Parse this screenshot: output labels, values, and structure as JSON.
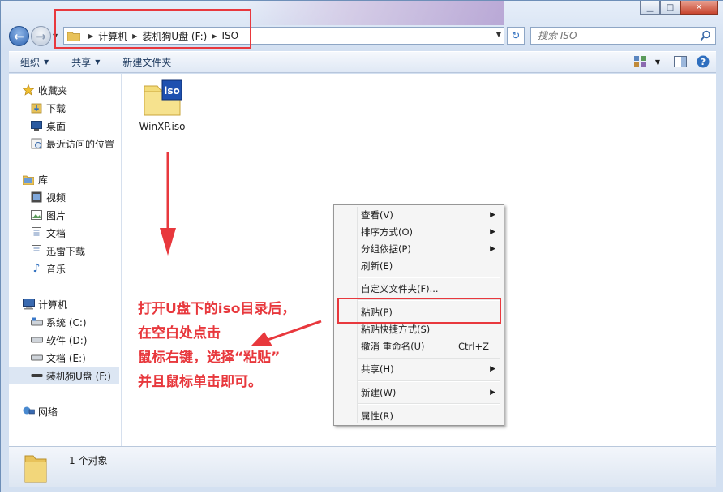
{
  "window": {
    "caption_buttons": {
      "minimize": "▁",
      "maximize": "□",
      "close": "✕"
    }
  },
  "nav": {
    "back_icon": "back-arrow-icon",
    "forward_icon": "forward-arrow-icon"
  },
  "address": {
    "crumbs": [
      "计算机",
      "装机狗U盘 (F:)",
      "ISO"
    ]
  },
  "search": {
    "placeholder": "搜索 ISO"
  },
  "toolbar": {
    "organize": "组织",
    "share": "共享",
    "new_folder": "新建文件夹"
  },
  "sidebar": {
    "favorites": {
      "label": "收藏夹",
      "items": [
        "下载",
        "桌面",
        "最近访问的位置"
      ]
    },
    "libraries": {
      "label": "库",
      "items": [
        "视频",
        "图片",
        "文档",
        "迅雷下载",
        "音乐"
      ]
    },
    "computer": {
      "label": "计算机",
      "items": [
        "系统 (C:)",
        "软件 (D:)",
        "文档 (E:)",
        "装机狗U盘 (F:)"
      ]
    },
    "network": {
      "label": "网络"
    }
  },
  "content": {
    "files": [
      {
        "name": "WinXP.iso",
        "icon_text": "iso"
      }
    ]
  },
  "annotation": {
    "lines": [
      "打开U盘下的iso目录后，",
      "在空白处点击",
      "鼠标右键，选择“粘贴”",
      "并且鼠标单击即可。"
    ],
    "color": "#e8383d"
  },
  "context_menu": {
    "view": "查看(V)",
    "sort_by": "排序方式(O)",
    "group_by": "分组依据(P)",
    "refresh": "刷新(E)",
    "customize": "自定义文件夹(F)...",
    "paste": "粘贴(P)",
    "paste_shortcut": "粘贴快捷方式(S)",
    "undo_rename": "撤消 重命名(U)",
    "undo_shortcut": "Ctrl+Z",
    "share_with": "共享(H)",
    "new": "新建(W)",
    "properties": "属性(R)"
  },
  "status": {
    "count": "1 个对象"
  }
}
